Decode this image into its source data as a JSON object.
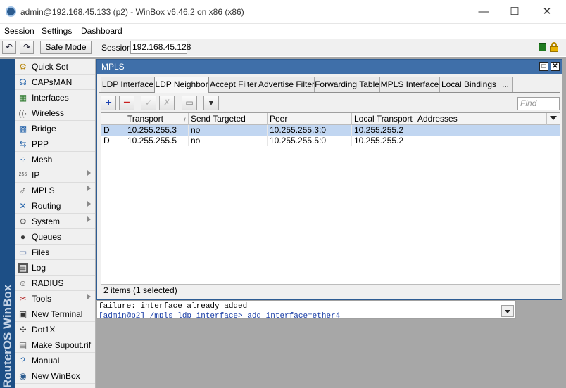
{
  "window": {
    "title": "admin@192.168.45.133 (p2) - WinBox v6.46.2 on x86 (x86)",
    "minimize": "—",
    "maximize": "☐",
    "close": "✕"
  },
  "menu": {
    "session": "Session",
    "settings": "Settings",
    "dashboard": "Dashboard"
  },
  "toolbar": {
    "undo": "↶",
    "redo": "↷",
    "safe_mode": "Safe Mode",
    "session_label": "Session:",
    "session_value": "192.168.45.128"
  },
  "brand": "RouterOS WinBox",
  "sidebar": {
    "items": [
      {
        "label": "Quick Set",
        "icon": "quick-set-icon",
        "glyph": "⚙",
        "color": "#b8860b"
      },
      {
        "label": "CAPsMAN",
        "icon": "capsman-icon",
        "glyph": "☊",
        "color": "#1e5fa8"
      },
      {
        "label": "Interfaces",
        "icon": "interfaces-icon",
        "glyph": "▦",
        "color": "#2d7a2d"
      },
      {
        "label": "Wireless",
        "icon": "wireless-icon",
        "glyph": "((·",
        "color": "#555"
      },
      {
        "label": "Bridge",
        "icon": "bridge-icon",
        "glyph": "▩",
        "color": "#1e5fa8"
      },
      {
        "label": "PPP",
        "icon": "ppp-icon",
        "glyph": "⇆",
        "color": "#1e5fa8"
      },
      {
        "label": "Mesh",
        "icon": "mesh-icon",
        "glyph": "⁘",
        "color": "#1e5fa8"
      },
      {
        "label": "IP",
        "icon": "ip-icon",
        "glyph": "255",
        "color": "#555"
      },
      {
        "label": "MPLS",
        "icon": "mpls-icon",
        "glyph": "⇗",
        "color": "#777"
      },
      {
        "label": "Routing",
        "icon": "routing-icon",
        "glyph": "✕",
        "color": "#1e5fa8"
      },
      {
        "label": "System",
        "icon": "system-icon",
        "glyph": "⚙",
        "color": "#666"
      },
      {
        "label": "Queues",
        "icon": "queues-icon",
        "glyph": "●",
        "color": "#3b3b3b"
      },
      {
        "label": "Files",
        "icon": "files-icon",
        "glyph": "▭",
        "color": "#4f6fa3"
      },
      {
        "label": "Log",
        "icon": "log-icon",
        "glyph": "▤",
        "color": "#fff"
      },
      {
        "label": "RADIUS",
        "icon": "radius-icon",
        "glyph": "☺",
        "color": "#444"
      },
      {
        "label": "Tools",
        "icon": "tools-icon",
        "glyph": "✂",
        "color": "#b22222"
      },
      {
        "label": "New Terminal",
        "icon": "terminal-icon",
        "glyph": "▣",
        "color": "#333"
      },
      {
        "label": "Dot1X",
        "icon": "dot1x-icon",
        "glyph": "✣",
        "color": "#333"
      },
      {
        "label": "Make Supout.rif",
        "icon": "supout-icon",
        "glyph": "▤",
        "color": "#666"
      },
      {
        "label": "Manual",
        "icon": "manual-icon",
        "glyph": "?",
        "color": "#1e5fa8"
      },
      {
        "label": "New WinBox",
        "icon": "winbox-icon",
        "glyph": "◉",
        "color": "#2b5b8f"
      }
    ]
  },
  "mpls": {
    "title": "MPLS",
    "tabs": [
      "LDP Interface",
      "LDP Neighbor",
      "Accept Filter",
      "Advertise Filter",
      "Forwarding Table",
      "MPLS Interface",
      "Local Bindings",
      "..."
    ],
    "active_tab": "LDP Neighbor",
    "buttons": {
      "add": "+",
      "remove": "−",
      "enable": "✓",
      "disable": "✗",
      "comment": "▭",
      "filter": "▼"
    },
    "find_placeholder": "Find",
    "columns": [
      "",
      "Transport",
      "Send Targeted",
      "Peer",
      "Local Transport",
      "Addresses"
    ],
    "sort_indicator": "/",
    "rows": [
      {
        "flag": "D",
        "transport": "10.255.255.3",
        "send_targeted": "no",
        "peer": "10.255.255.3:0",
        "local_transport": "10.255.255.2",
        "addresses": ""
      },
      {
        "flag": "D",
        "transport": "10.255.255.5",
        "send_targeted": "no",
        "peer": "10.255.255.5:0",
        "local_transport": "10.255.255.2",
        "addresses": ""
      }
    ],
    "status": "2 items (1 selected)"
  },
  "terminal": {
    "line1": "failure: interface already added",
    "line2": "[admin@p2] /mpls ldp interface> add interface=ether4"
  },
  "colors": {
    "accent": "#3f6fa9",
    "selection": "#c1d6f1",
    "brand": "#1d4f86"
  }
}
